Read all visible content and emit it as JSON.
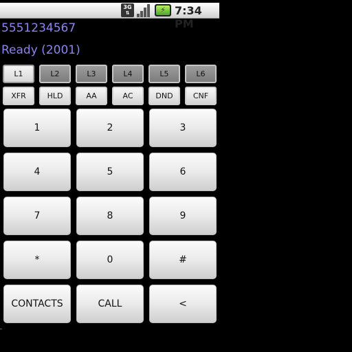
{
  "status_bar": {
    "network_label": "3G",
    "network_arrows": "⇅",
    "battery_glyph": "⚡",
    "time": "7:34 PM"
  },
  "dialer": {
    "number": "5551234567",
    "status": "Ready (2001)"
  },
  "lines": [
    {
      "label": "L1",
      "active": true
    },
    {
      "label": "L2",
      "active": false
    },
    {
      "label": "L3",
      "active": false
    },
    {
      "label": "L4",
      "active": false
    },
    {
      "label": "L5",
      "active": false
    },
    {
      "label": "L6",
      "active": false
    }
  ],
  "functions": [
    "XFR",
    "HLD",
    "AA",
    "AC",
    "DND",
    "CNF"
  ],
  "keypad": [
    [
      "1",
      "2",
      "3"
    ],
    [
      "4",
      "5",
      "6"
    ],
    [
      "7",
      "8",
      "9"
    ],
    [
      "*",
      "0",
      "#"
    ],
    [
      "CONTACTS",
      "CALL",
      "<"
    ]
  ],
  "colors": {
    "status_text": "#8b86e8",
    "background": "#000000"
  }
}
